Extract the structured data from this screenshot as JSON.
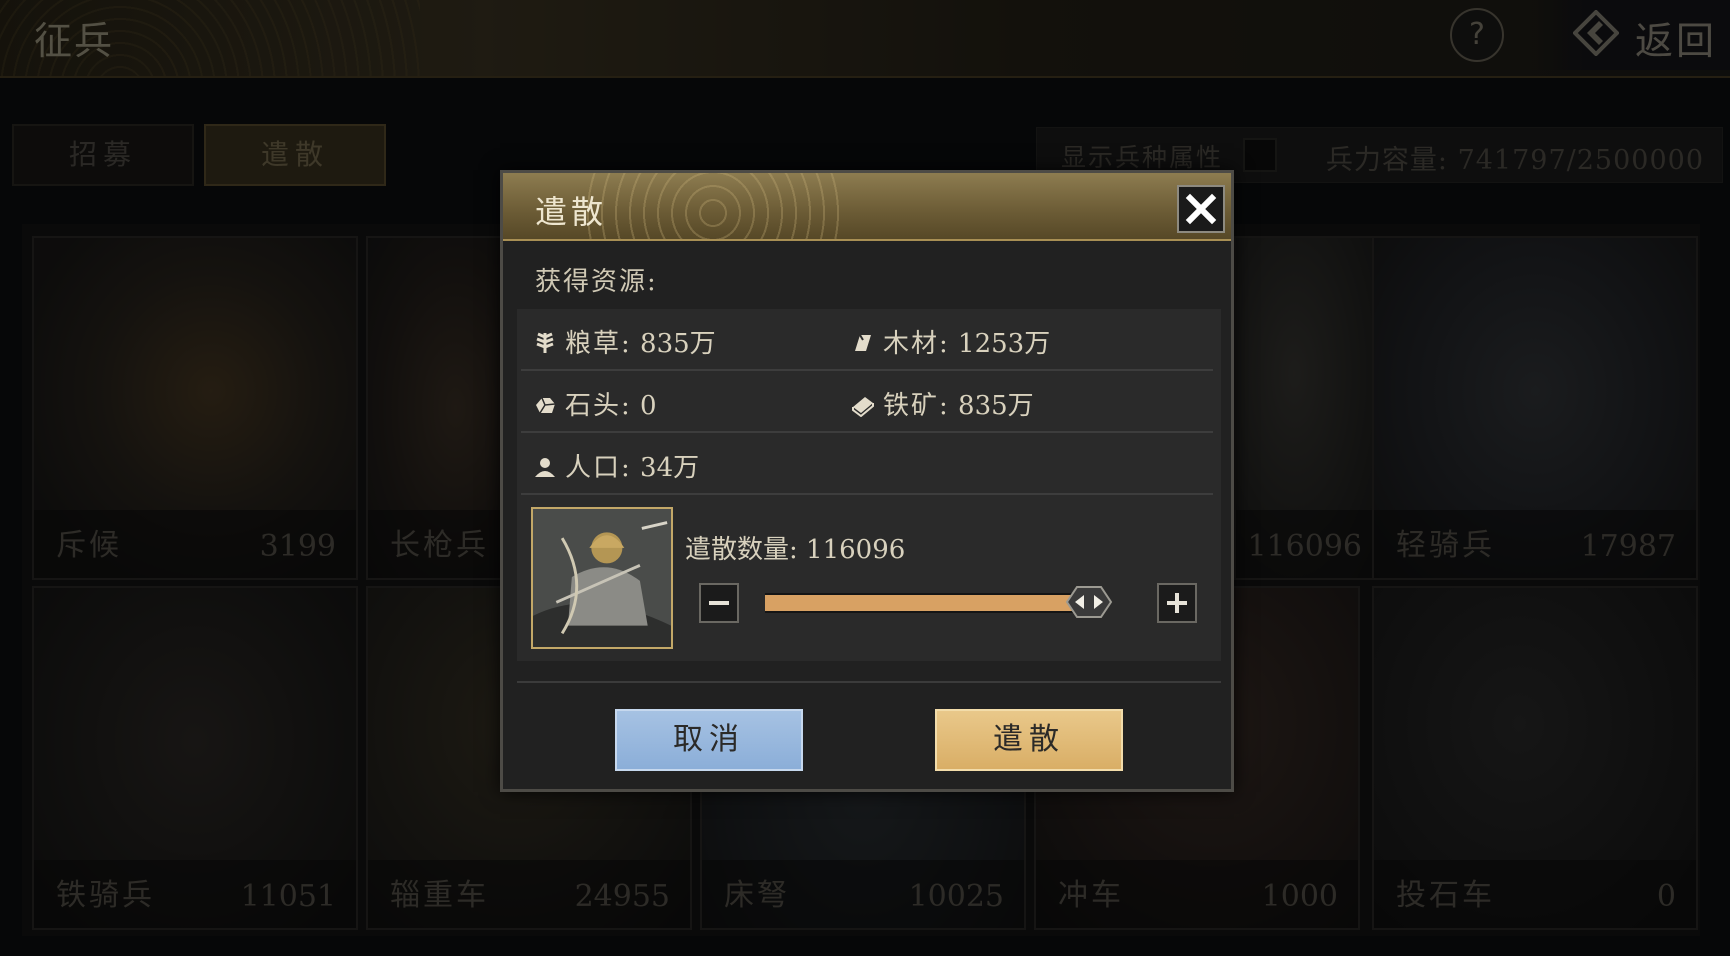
{
  "header": {
    "title": "征兵",
    "help_label": "?",
    "back_label": "返回"
  },
  "tabs": [
    {
      "label": "招募"
    },
    {
      "label": "遣散"
    }
  ],
  "filter": {
    "show_attr_label": "显示兵种属性",
    "capacity_label": "兵力容量:",
    "capacity_value": "741797/2500000"
  },
  "units": [
    {
      "name": "斥候",
      "count": "3199"
    },
    {
      "name": "长枪兵",
      "count": ""
    },
    {
      "name": "",
      "count": ""
    },
    {
      "name": "",
      "count": "116096"
    },
    {
      "name": "轻骑兵",
      "count": "17987"
    },
    {
      "name": "铁骑兵",
      "count": "11051"
    },
    {
      "name": "辎重车",
      "count": "24955"
    },
    {
      "name": "床弩",
      "count": "10025"
    },
    {
      "name": "冲车",
      "count": "1000"
    },
    {
      "name": "投石车",
      "count": "0"
    }
  ],
  "dialog": {
    "title": "遣散",
    "resources_label": "获得资源:",
    "resources": [
      {
        "icon": "grain-icon",
        "label": "粮草:",
        "value": "835万"
      },
      {
        "icon": "wood-icon",
        "label": "木材:",
        "value": "1253万"
      },
      {
        "icon": "stone-icon",
        "label": "石头:",
        "value": "0"
      },
      {
        "icon": "iron-ore-icon",
        "label": "铁矿:",
        "value": "835万"
      },
      {
        "icon": "population-icon",
        "label": "人口:",
        "value": "34万"
      }
    ],
    "quantity_label": "遣散数量:",
    "quantity_value": "116096",
    "slider_fraction": 1.0,
    "cancel_label": "取消",
    "confirm_label": "遣散"
  },
  "colors": {
    "accent_gold": "#d9ae66",
    "cancel_blue": "#8baed8",
    "slider_fill": "#d8a163"
  }
}
